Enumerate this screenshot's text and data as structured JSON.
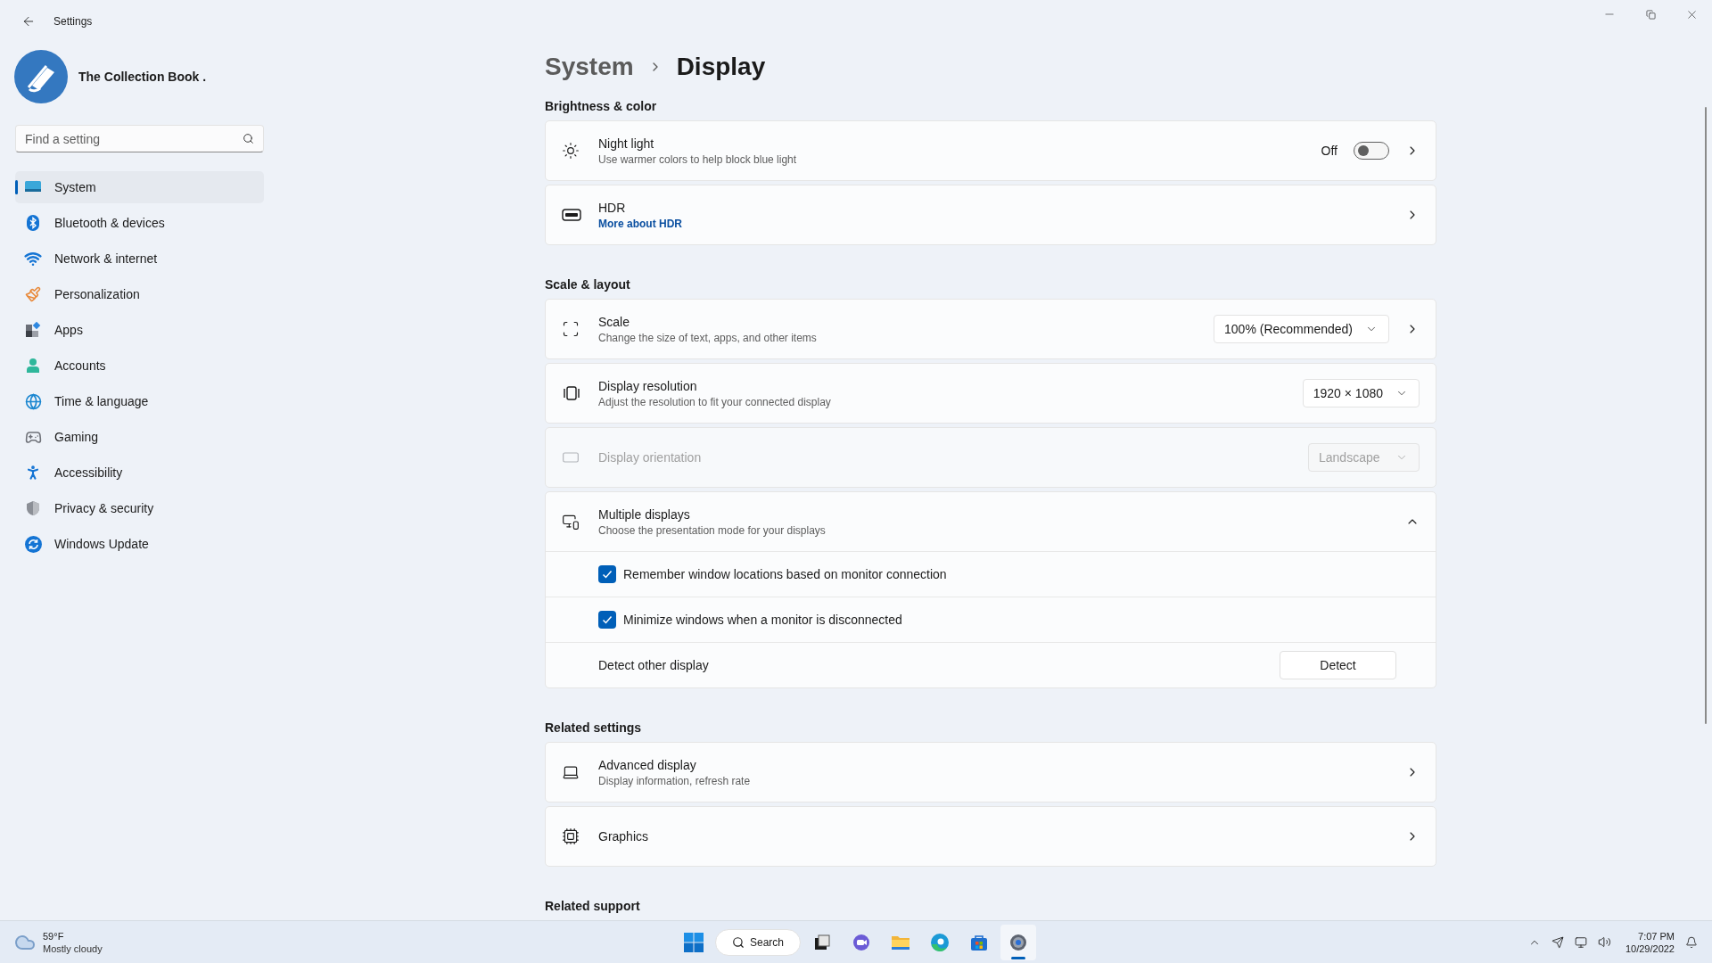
{
  "window": {
    "title": "Settings"
  },
  "profile": {
    "name": "The Collection Book ."
  },
  "search": {
    "placeholder": "Find a setting"
  },
  "nav": [
    {
      "label": "System",
      "selected": true
    },
    {
      "label": "Bluetooth & devices",
      "selected": false
    },
    {
      "label": "Network & internet",
      "selected": false
    },
    {
      "label": "Personalization",
      "selected": false
    },
    {
      "label": "Apps",
      "selected": false
    },
    {
      "label": "Accounts",
      "selected": false
    },
    {
      "label": "Time & language",
      "selected": false
    },
    {
      "label": "Gaming",
      "selected": false
    },
    {
      "label": "Accessibility",
      "selected": false
    },
    {
      "label": "Privacy & security",
      "selected": false
    },
    {
      "label": "Windows Update",
      "selected": false
    }
  ],
  "breadcrumb": {
    "parent": "System",
    "current": "Display"
  },
  "sections": [
    {
      "heading": "Brightness & color",
      "cards": [
        {
          "kind": "toggle",
          "title": "Night light",
          "subtitle": "Use warmer colors to help block blue light",
          "state_label": "Off",
          "on": false,
          "chevron": true,
          "disabled": false
        },
        {
          "kind": "link",
          "title": "HDR",
          "link": "More about HDR",
          "chevron": true,
          "disabled": false
        }
      ]
    },
    {
      "heading": "Scale & layout",
      "cards": [
        {
          "kind": "dropdown",
          "title": "Scale",
          "subtitle": "Change the size of text, apps, and other items",
          "value": "100% (Recommended)",
          "chevron": true,
          "disabled": false
        },
        {
          "kind": "dropdown",
          "title": "Display resolution",
          "subtitle": "Adjust the resolution to fit your connected display",
          "value": "1920 × 1080",
          "chevron": false,
          "disabled": false
        },
        {
          "kind": "dropdown",
          "title": "Display orientation",
          "value": "Landscape",
          "chevron": false,
          "disabled": true
        },
        {
          "kind": "expander",
          "title": "Multiple displays",
          "subtitle": "Choose the presentation mode for your displays",
          "expanded": true,
          "chevron": false,
          "disabled": false,
          "children": [
            {
              "kind": "checkbox",
              "label": "Remember window locations based on monitor connection",
              "checked": true
            },
            {
              "kind": "checkbox",
              "label": "Minimize windows when a monitor is disconnected",
              "checked": true
            },
            {
              "kind": "button",
              "label": "Detect other display",
              "button": "Detect"
            }
          ]
        }
      ]
    },
    {
      "heading": "Related settings",
      "cards": [
        {
          "kind": "link",
          "title": "Advanced display",
          "subtitle": "Display information, refresh rate",
          "chevron": true,
          "disabled": false
        },
        {
          "kind": "link",
          "title": "Graphics",
          "chevron": true,
          "disabled": false
        }
      ]
    },
    {
      "heading": "Related support"
    }
  ],
  "taskbar": {
    "weather": {
      "temperature": "59°F",
      "condition": "Mostly cloudy"
    },
    "search": "Search",
    "apps": [
      {
        "kind": "start",
        "selected": false
      },
      {
        "kind": "search",
        "selected": false
      },
      {
        "kind": "taskview",
        "selected": false
      },
      {
        "kind": "chat",
        "selected": false
      },
      {
        "kind": "explorer",
        "selected": false
      },
      {
        "kind": "edge",
        "selected": false
      },
      {
        "kind": "store",
        "selected": false
      },
      {
        "kind": "settings",
        "selected": true
      }
    ],
    "time": "7:07 PM",
    "date": "10/29/2022"
  }
}
